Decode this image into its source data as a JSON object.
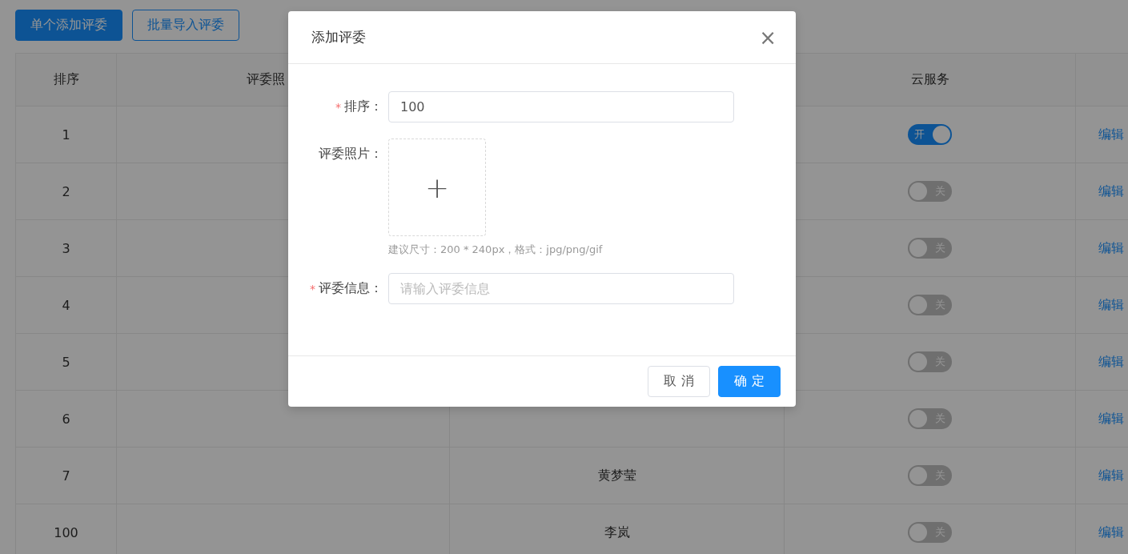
{
  "toolbar": {
    "buttons": [
      {
        "label": "单个添加评委",
        "kind": "primary"
      },
      {
        "label": "批量导入评委",
        "kind": "outline"
      }
    ]
  },
  "table": {
    "columns": [
      "排序",
      "评委照",
      "",
      "云服务",
      ""
    ],
    "rows": [
      {
        "order": "1",
        "name": "",
        "cloud": {
          "on": true,
          "label": "开"
        },
        "action": "编辑"
      },
      {
        "order": "2",
        "name": "",
        "cloud": {
          "on": false,
          "label": "关"
        },
        "action": "编辑"
      },
      {
        "order": "3",
        "name": "",
        "cloud": {
          "on": false,
          "label": "关"
        },
        "action": "编辑"
      },
      {
        "order": "4",
        "name": "",
        "cloud": {
          "on": false,
          "label": "关"
        },
        "action": "编辑"
      },
      {
        "order": "5",
        "name": "",
        "cloud": {
          "on": false,
          "label": "关"
        },
        "action": "编辑"
      },
      {
        "order": "6",
        "name": "",
        "cloud": {
          "on": false,
          "label": "关"
        },
        "action": "编辑"
      },
      {
        "order": "7",
        "name": "黄梦莹",
        "cloud": {
          "on": false,
          "label": "关"
        },
        "action": "编辑"
      },
      {
        "order": "100",
        "name": "李岚",
        "cloud": {
          "on": false,
          "label": "关"
        },
        "action": "编辑"
      }
    ]
  },
  "dialog": {
    "title": "添加评委",
    "close": "×",
    "required_mark": "*",
    "fields": [
      {
        "kind": "input",
        "label": "排序：",
        "required": true,
        "value": "100"
      },
      {
        "kind": "upload",
        "label": "评委照片：",
        "required": false,
        "plus": "+",
        "hint": "建议尺寸：200 * 240px，格式：jpg/png/gif"
      },
      {
        "kind": "input",
        "label": "评委信息：",
        "required": true,
        "placeholder": "请输入评委信息"
      }
    ],
    "buttons": [
      {
        "label": "取 消",
        "kind": "default"
      },
      {
        "label": "确 定",
        "kind": "primary"
      }
    ]
  }
}
